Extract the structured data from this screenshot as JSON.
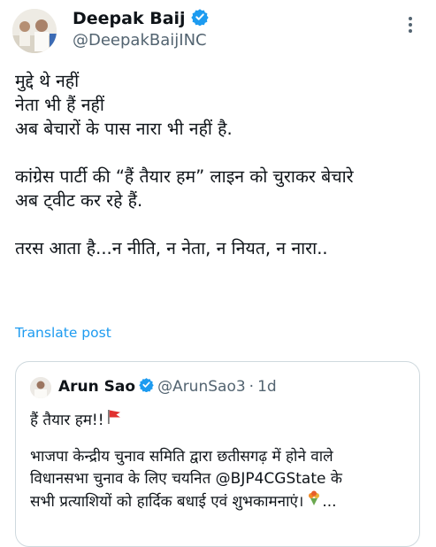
{
  "author": {
    "display_name": "Deepak Baij",
    "handle": "@DeepakBaijINC",
    "verified": true,
    "avatar_icon": "user-avatar-photo"
  },
  "tweet": {
    "lines": [
      "मुद्दे थे नहीं",
      "नेता भी हैं नहीं",
      "अब बेचारों के पास नारा भी नहीं है.",
      "",
      "कांग्रेस पार्टी की “हैं तैयार हम” लाइन को चुराकर बेचारे",
      "अब ट्वीट कर रहे हैं.",
      "",
      "तरस आता है...न नीति, न नेता, न नियत, न नारा.."
    ],
    "translate_label": "Translate post"
  },
  "quoted_tweet": {
    "display_name": "Arun Sao",
    "handle": "@ArunSao3",
    "separator": "·",
    "time": "1d",
    "verified": true,
    "line1": "हैं तैयार हम!!",
    "line2": "भाजपा केन्द्रीय चुनाव समिति द्वारा छतीसगढ़ में होने वाले",
    "line3": "विधानसभा चुनाव के लिए चयनित @BJP4CGState के",
    "line4": "सभी प्रत्याशियों को हार्दिक बधाई एवं शुभकामनाएं।",
    "line4_suffix": "...",
    "icons": [
      "red-flag-icon",
      "bouquet-icon"
    ]
  },
  "colors": {
    "verified_badge": "#1d9bf0",
    "link": "#1d9bf0",
    "secondary_text": "#536471",
    "border": "#cfd9de",
    "flag": "#e0302f"
  }
}
